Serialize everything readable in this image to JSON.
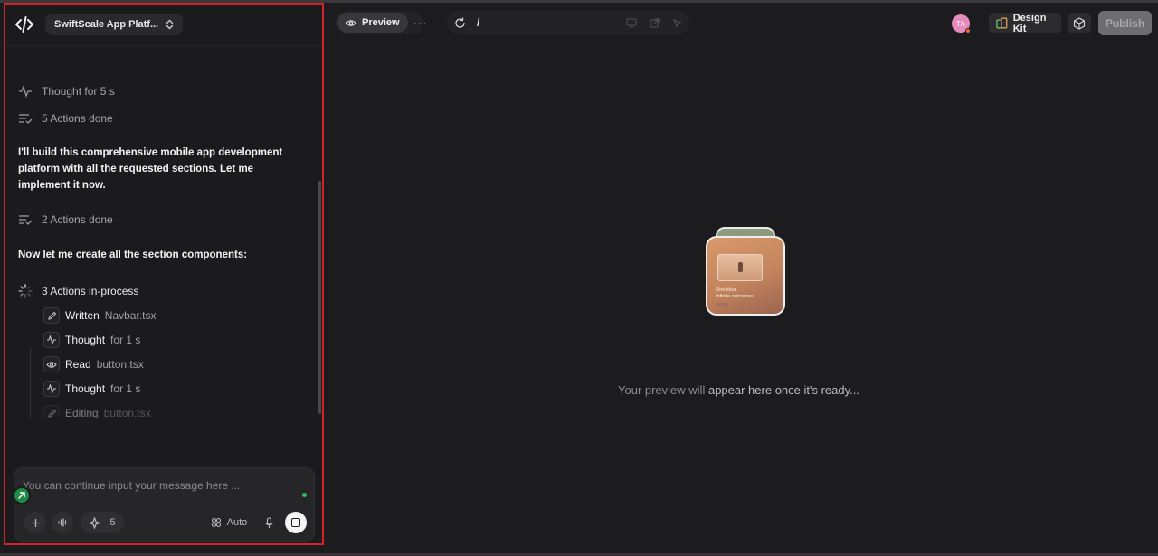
{
  "project": {
    "name": "SwiftScale App Platf..."
  },
  "chat": {
    "thought_1": {
      "label": "Thought for",
      "value": "5 s"
    },
    "actions_1": {
      "label": "5 Actions done"
    },
    "message_1": "I'll build this comprehensive mobile app development platform with all the requested sections. Let me implement it now.",
    "actions_2": {
      "label": "2 Actions done"
    },
    "message_2": "Now let me create all the section components:",
    "actions_3": {
      "label": "3 Actions in-process"
    },
    "steps": [
      {
        "action": "Written",
        "target": "Navbar.tsx",
        "icon": "pencil-icon"
      },
      {
        "action": "Thought",
        "target": "for 1 s",
        "icon": "pulse-icon"
      },
      {
        "action": "Read",
        "target": "button.tsx",
        "icon": "eye-icon"
      },
      {
        "action": "Thought",
        "target": "for 1 s",
        "icon": "pulse-icon"
      },
      {
        "action": "Editing",
        "target": "button.tsx",
        "icon": "pencil-icon"
      }
    ]
  },
  "composer": {
    "placeholder": "You can continue input your message here ...",
    "credits": "5",
    "mode": "Auto"
  },
  "toolbar": {
    "preview_label": "Preview",
    "more_label": "···",
    "url": "/",
    "avatar_initials": "TA",
    "design_kit_label": "Design Kit",
    "publish_label": "Publish"
  },
  "preview": {
    "card_caption_1": "One idea.",
    "card_caption_2": "Infinite outcomes.",
    "msg_part1": "Your preview will",
    "msg_part2": "appear here once it's ready..."
  },
  "colors": {
    "accent_green": "#2fbf5f",
    "panel_border": "#d1232a",
    "avatar": "#e58bbd"
  }
}
